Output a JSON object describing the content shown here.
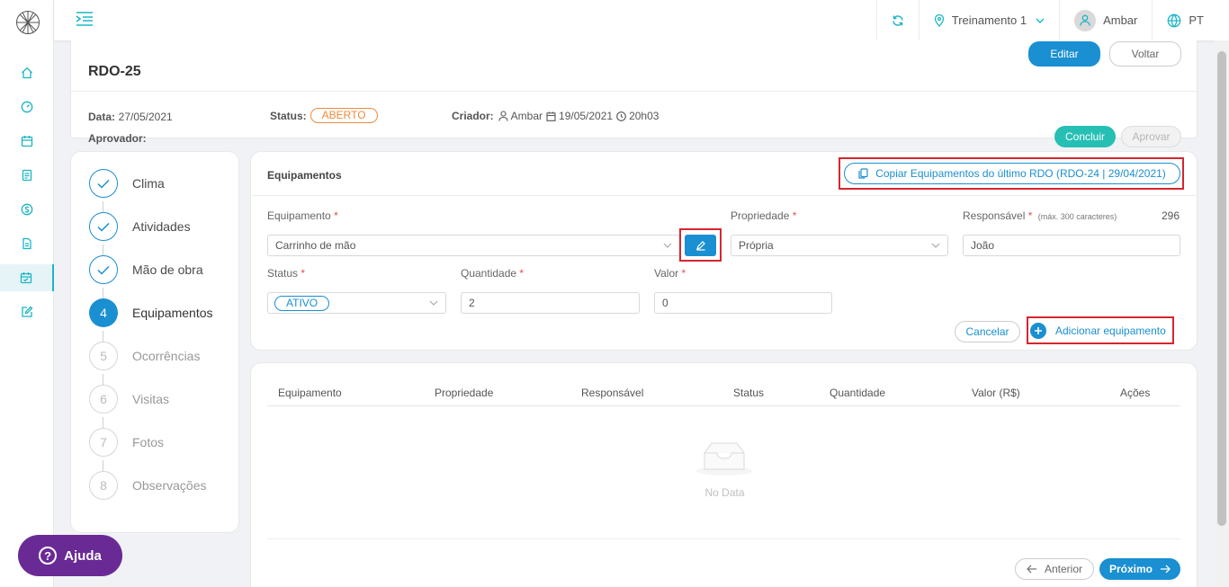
{
  "topbar": {
    "project": "Treinamento 1",
    "user": "Ambar",
    "language": "PT"
  },
  "header": {
    "rdo_title": "RDO-25",
    "edit_label": "Editar",
    "back_label": "Voltar",
    "date_label": "Data:",
    "date_value": "27/05/2021",
    "status_label": "Status:",
    "status_value": "ABERTO",
    "creator_label": "Criador:",
    "creator_name": "Ambar",
    "created_date": "19/05/2021",
    "created_time": "20h03",
    "approver_label": "Aprovador:",
    "conclude_label": "Concluir",
    "approve_label": "Aprovar"
  },
  "steps": [
    {
      "num": "1",
      "label": "Clima",
      "state": "done"
    },
    {
      "num": "2",
      "label": "Atividades",
      "state": "done"
    },
    {
      "num": "3",
      "label": "Mão de obra",
      "state": "done"
    },
    {
      "num": "4",
      "label": "Equipamentos",
      "state": "current"
    },
    {
      "num": "5",
      "label": "Ocorrências",
      "state": "todo"
    },
    {
      "num": "6",
      "label": "Visitas",
      "state": "todo"
    },
    {
      "num": "7",
      "label": "Fotos",
      "state": "todo"
    },
    {
      "num": "8",
      "label": "Observações",
      "state": "todo"
    }
  ],
  "form": {
    "section_title": "Equipamentos",
    "copy_label": "Copiar Equipamentos do último RDO (RDO-24 | 29/04/2021)",
    "equipment_label": "Equipamento",
    "equipment_value": "Carrinho de mão",
    "property_label": "Propriedade",
    "property_value": "Própria",
    "responsible_label": "Responsável",
    "responsible_hint": "(máx. 300 caracteres)",
    "responsible_count": "296",
    "responsible_value": "João",
    "status_label": "Status",
    "status_value": "ATIVO",
    "quantity_label": "Quantidade",
    "quantity_value": "2",
    "value_label": "Valor",
    "value_value": "0",
    "required_mark": "*",
    "cancel_label": "Cancelar",
    "add_label": "Adicionar equipamento"
  },
  "table": {
    "columns": [
      "Equipamento",
      "Propriedade",
      "Responsável",
      "Status",
      "Quantidade",
      "Valor (R$)",
      "Ações"
    ],
    "empty_text": "No Data",
    "prev_label": "Anterior",
    "next_label": "Próximo"
  },
  "help": {
    "label": "Ajuda"
  },
  "colors": {
    "primary": "#1a8fd1",
    "teal": "#26bfb4",
    "accent": "#1bb5c5",
    "highlight": "#d6262e",
    "status_open": "#f08a3c",
    "help": "#6a2a96"
  }
}
